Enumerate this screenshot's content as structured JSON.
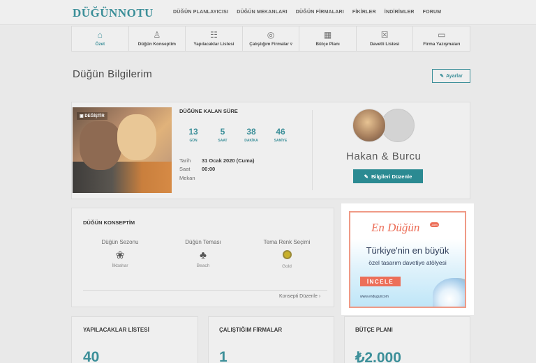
{
  "header": {
    "logo": "DÜĞÜNNOTU",
    "nav": [
      "DÜĞÜN PLANLAYICISI",
      "DÜĞÜN MEKANLARI",
      "DÜĞÜN FİRMALARI",
      "FİKİRLER",
      "İNDİRİMLER",
      "FORUM"
    ]
  },
  "subnav": [
    {
      "label": "Özet",
      "icon": "home-icon",
      "glyph": "⌂",
      "active": true
    },
    {
      "label": "Düğün Konseptim",
      "icon": "couple-icon",
      "glyph": "♙"
    },
    {
      "label": "Yapılacaklar Listesi",
      "icon": "checklist-icon",
      "glyph": "☷"
    },
    {
      "label": "Çalıştığım Firmalar ▿",
      "icon": "ring-icon",
      "glyph": "◎"
    },
    {
      "label": "Bütçe Planı",
      "icon": "calculator-icon",
      "glyph": "▦"
    },
    {
      "label": "Davetli Listesi",
      "icon": "guestlist-icon",
      "glyph": "☒"
    },
    {
      "label": "Firma Yazışmaları",
      "icon": "chat-icon",
      "glyph": "▭"
    }
  ],
  "page": {
    "title": "Düğün Bilgilerim",
    "settings_label": "Ayarlar"
  },
  "summary": {
    "change_photo": "DEĞİŞTİR",
    "countdown_title": "DÜĞÜNE KALAN SÜRE",
    "countdown": [
      {
        "value": "13",
        "unit": "GÜN"
      },
      {
        "value": "5",
        "unit": "SAAT"
      },
      {
        "value": "38",
        "unit": "DAKİKA"
      },
      {
        "value": "46",
        "unit": "SANİYE"
      }
    ],
    "date_label": "Tarih",
    "date_value": "31 Ocak 2020 (Cuma)",
    "time_label": "Saat",
    "time_value": "00:00",
    "venue_label": "Mekan",
    "couple_name": "Hakan & Burcu",
    "edit_info_label": "Bilgileri Düzenle"
  },
  "concept": {
    "title": "DÜĞÜN KONSEPTİM",
    "items": [
      {
        "heading": "Düğün Sezonu",
        "value": "İlkbahar",
        "icon": "flower-icon"
      },
      {
        "heading": "Düğün Teması",
        "value": "Beach",
        "icon": "palm-icon"
      },
      {
        "heading": "Tema Renk Seçimi",
        "value": "Gold",
        "icon": "color-swatch-icon",
        "color": "#c8b02a"
      }
    ],
    "edit_link": "Konsepti Düzenle"
  },
  "ad": {
    "logo": "En Düğün",
    "badge": ".com",
    "line1": "Türkiye'nin en büyük",
    "line2": "özel tasarım davetiye atölyesi",
    "button": "İNCELE",
    "url": "www.enduguncom"
  },
  "stats": [
    {
      "title": "YAPILACAKLAR LİSTESİ",
      "value": "40"
    },
    {
      "title": "ÇALIŞTIĞIM FİRMALAR",
      "value": "1"
    },
    {
      "title": "BÜTÇE PLANI",
      "value": "₺2.000"
    }
  ],
  "colors": {
    "accent": "#3c8f99",
    "button": "#2b8a92",
    "ad_coral": "#ec6f59"
  }
}
